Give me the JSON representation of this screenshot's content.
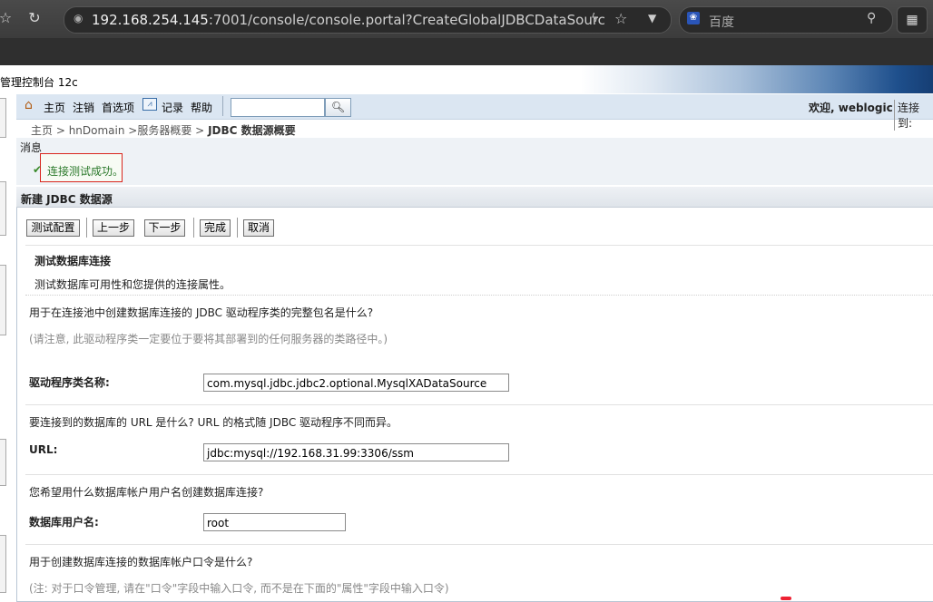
{
  "browser": {
    "url_host": "192.168.254.145",
    "url_rest": ":7001/console/console.portal?CreateGlobalJDBCDataSourc",
    "search_engine": "百度"
  },
  "console": {
    "title": "管理控制台 12c"
  },
  "nav": {
    "home": "主页",
    "logout": "注销",
    "preferences": "首选项",
    "record": "记录",
    "help": "帮助",
    "search_value": "",
    "welcome": "欢迎, weblogic",
    "connected_to": "连接到:"
  },
  "breadcrumb": {
    "items": [
      "主页 >",
      "hnDomain >",
      "服务器概要 >"
    ],
    "current": "JDBC 数据源概要"
  },
  "messages": {
    "label": "消息",
    "success": "连接测试成功。"
  },
  "panel": {
    "title": "新建 JDBC 数据源",
    "buttons": {
      "test_config": "测试配置",
      "back": "上一步",
      "next": "下一步",
      "finish": "完成",
      "cancel": "取消"
    },
    "section_title": "测试数据库连接",
    "section_desc": "测试数据库可用性和您提供的连接属性。",
    "q_driver": "用于在连接池中创建数据库连接的 JDBC 驱动程序类的完整包名是什么?",
    "q_driver_note": "(请注意, 此驱动程序类一定要位于要将其部署到的任何服务器的类路径中。)",
    "driver_label": "驱动程序类名称:",
    "driver_value": "com.mysql.jdbc.jdbc2.optional.MysqlXADataSource",
    "q_url": "要连接到的数据库的 URL 是什么? URL 的格式随 JDBC 驱动程序不同而异。",
    "url_label": "URL:",
    "url_value": "jdbc:mysql://192.168.31.99:3306/ssm",
    "q_user": "您希望用什么数据库帐户用户名创建数据库连接?",
    "user_label": "数据库用户名:",
    "user_value": "root",
    "q_password": "用于创建数据库连接的数据库帐户口令是什么?",
    "q_password_note": "(注: 对于口令管理, 请在\"口令\"字段中输入口令, 而不是在下面的\"属性\"字段中输入口令)"
  },
  "icons": {
    "home": "home-icon",
    "record": "chart-icon",
    "search": "magnifier-icon",
    "success": "check-icon"
  }
}
